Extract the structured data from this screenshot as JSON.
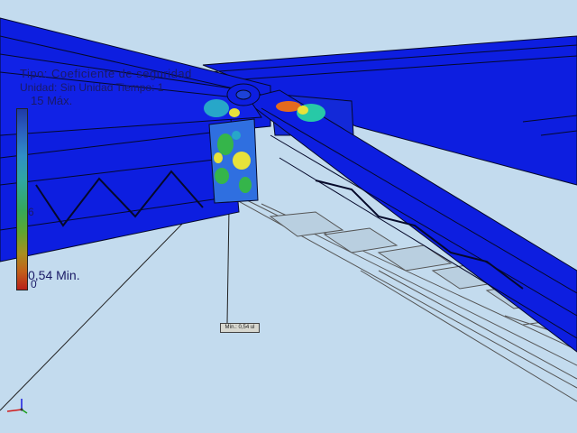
{
  "legend": {
    "title_line1": "Tipo: Coeficiente de seguridad",
    "title_line2": "Unidad: Sin Unidad  Tiempo: 1",
    "title_line3": "15 Máx.",
    "tick_mid": "6",
    "tick_min": "0,54 Min.",
    "tick_zero": "0"
  },
  "probe": {
    "label": "Mín.: 0,54 ul"
  },
  "colors": {
    "background": "#c3dbee",
    "beam_blue": "#0d1ee0",
    "edge": "#05092a",
    "stress_green": "#35b54a",
    "stress_yellow": "#e7e23a",
    "stress_orange": "#e46a1e"
  },
  "icons": {
    "triad": "xyz-axis-triad-icon"
  }
}
